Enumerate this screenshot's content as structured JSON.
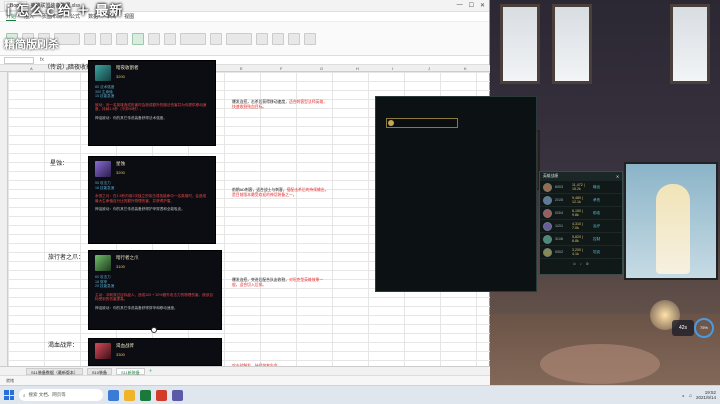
{
  "overlay": {
    "title": "ｉ怎么ｃ给 ＋ 最新",
    "subtitle": "精简版刷杀"
  },
  "excel": {
    "title_bar": {
      "tab_label": "Book",
      "doc_title": "英雄联盟装备数据.xlsx"
    },
    "menu": [
      "开始",
      "插入",
      "页面布局",
      "公式",
      "数据",
      "审阅",
      "视图"
    ],
    "menu_active": "开始",
    "columns": [
      "A",
      "B",
      "C",
      "D",
      "E",
      "F",
      "G",
      "H",
      "I",
      "J",
      "K",
      "L",
      "M"
    ],
    "sheets": [
      "S11装备数据（最新版本）",
      "S10装备",
      "S11新装备"
    ],
    "active_sheet": "S11新装备",
    "status": "就绪"
  },
  "rows": [
    {
      "label": "（传说）暗夜收割者：",
      "item_name": "暗夜收割者",
      "price": "3200",
      "stats": [
        "80 法术强度",
        "300 生命值",
        "15 技能急速"
      ],
      "desc_red": "被动：对一名英雄造成伤害时会造成额外的魔法伤害并为你提供移动速度，持续1.5秒（冷却40秒）。",
      "desc": "神话被动：你的其它传说装备获得法术强度。",
      "note_main": "爆发连招，击杀后获得移动速度，",
      "note_red": "适合刺客型法师英雄，快速收割残血目标。"
    },
    {
      "label": "星蚀：",
      "item_name": "星蚀",
      "price": "3200",
      "stats": [
        "55 攻击力",
        "18 技能急速"
      ],
      "desc_red": "永恒之月：在1.5秒内用2次独立的攻击或技能命中一名英雄时，会造成最大生命值百分比的额外物理伤害，并获得护盾。",
      "desc": "神话被动：你的其它传说装备获得护甲穿透和全能吸血。",
      "note_main": "前期AD刺客，适合战士与刺客，",
      "note_red": "搭配击杀后的持续输出，是目前版本最受欢迎的神话装备之一。"
    },
    {
      "label": "旅行者之爪：",
      "item_name": "暗行者之爪",
      "price": "3100",
      "stats": [
        "60 攻击力",
        "18 穿甲",
        "20 技能急速"
      ],
      "desc_red": "主动：冲刺穿过目标敌人，造成100 + 30%额外攻击力的物理伤害，使该目标受到的伤害提高。",
      "desc": "神话被动：你的其它传说装备获得穿甲和移动速度。",
      "note_main": "爆发连招，突进后配合队友收割，",
      "note_red": "对坦克型英雄效果一般，适合切入后排。"
    },
    {
      "label": "渴血战斧：",
      "item_name": "渴血战斧",
      "price": "3300",
      "stats": [
        "45 攻击力",
        "450 生命值"
      ],
      "desc_red": "",
      "desc": "",
      "note_main": "",
      "note_red": "攻击时触发，持续恢复生命。"
    }
  ],
  "scoreboard": {
    "title": "英雄战绩",
    "players": [
      {
        "kda": "6/0/3",
        "gold": "11,472 | 15.2k",
        "tag": "输出"
      },
      {
        "kda": "2/1/5",
        "gold": "9,480 | 12.1k",
        "tag": "承伤"
      },
      {
        "kda": "0/3/4",
        "gold": "6,150 | 9.8k",
        "tag": "助攻"
      },
      {
        "kda": "1/2/1",
        "gold": "4,310 | 7.0k",
        "tag": "治疗"
      },
      {
        "kda": "3/1/6",
        "gold": "5,820 | 8.8k",
        "tag": "控制"
      },
      {
        "kda": "0/0/2",
        "gold": "3,200 | 4.1k",
        "tag": "坦克"
      }
    ]
  },
  "badges": {
    "left": "42s",
    "ring": "75%"
  },
  "taskbar": {
    "search_placeholder": "搜索 文档、网页等",
    "time": "19:52",
    "date": "2021/9/14"
  },
  "colors": {
    "accent": "#1a7a3c",
    "card_bg": "#0b0d12",
    "red": "#e52b2b",
    "gold": "#e7c36a"
  }
}
